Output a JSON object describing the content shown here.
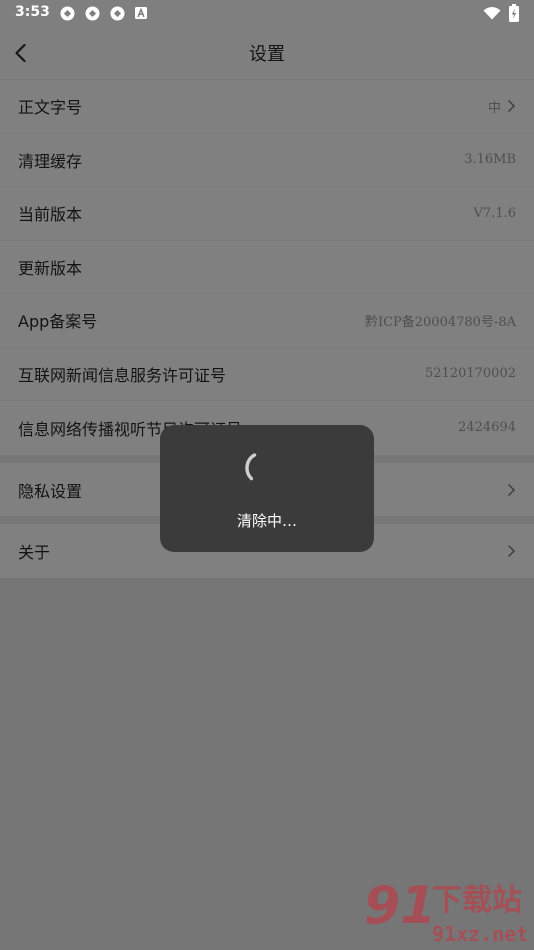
{
  "status_bar": {
    "time": "3:53",
    "notification_icons": [
      "app-notification-icon",
      "app-notification-icon",
      "app-notification-icon",
      "a-notification-icon"
    ],
    "system_icons": [
      "wifi-icon",
      "battery-charging-icon"
    ]
  },
  "header": {
    "back_icon": "chevron-left-icon",
    "title": "设置"
  },
  "groups": [
    {
      "items": [
        {
          "label": "正文字号",
          "value": "中",
          "chevron": true
        },
        {
          "label": "清理缓存",
          "value": "3.16MB"
        },
        {
          "label": "当前版本",
          "value": "V7.1.6"
        },
        {
          "label": "更新版本"
        },
        {
          "label": "App备案号",
          "value": "黔ICP备20004780号-8A"
        },
        {
          "label": "互联网新闻信息服务许可证号",
          "value": "52120170002"
        },
        {
          "label": "信息网络传播视听节目许可证号",
          "value": "2424694"
        }
      ]
    },
    {
      "items": [
        {
          "label": "隐私设置",
          "chevron": true
        }
      ]
    },
    {
      "items": [
        {
          "label": "关于",
          "chevron": true
        }
      ]
    }
  ],
  "toast": {
    "icon": "loading-spinner-icon",
    "message": "清除中…"
  },
  "watermark": {
    "logo": "91",
    "name": "下载站",
    "url": "91xz.net"
  },
  "colors": {
    "dimmed_background": "#808080",
    "toast_background": "#3b3b3b",
    "watermark_red": "#c8323f"
  }
}
